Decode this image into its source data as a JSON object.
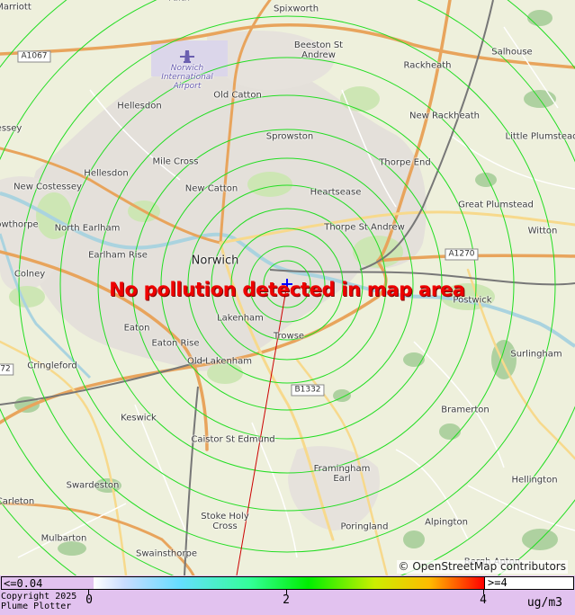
{
  "map": {
    "message": "No pollution detected in map area",
    "attribution": "© OpenStreetMap contributors",
    "places": [
      {
        "id": "faith",
        "name": "Faith"
      },
      {
        "id": "spixworth",
        "name": "Spixworth"
      },
      {
        "id": "marriott",
        "name": "Marriott"
      },
      {
        "id": "beeston-st-andrew",
        "name": "Beeston St\nAndrew"
      },
      {
        "id": "salhouse",
        "name": "Salhouse"
      },
      {
        "id": "rackheath",
        "name": "Rackheath"
      },
      {
        "id": "norwich-airport",
        "name": "Norwich\nInternational\nAirport"
      },
      {
        "id": "old-catton",
        "name": "Old Catton"
      },
      {
        "id": "hellesdon-north",
        "name": "Hellesdon"
      },
      {
        "id": "essey",
        "name": "essey"
      },
      {
        "id": "new-rackheath",
        "name": "New Rackheath"
      },
      {
        "id": "sprowston",
        "name": "Sprowston"
      },
      {
        "id": "little-plumstead",
        "name": "Little Plumstead"
      },
      {
        "id": "mile-cross",
        "name": "Mile Cross"
      },
      {
        "id": "thorpe-end",
        "name": "Thorpe End"
      },
      {
        "id": "hellesdon",
        "name": "Hellesdon"
      },
      {
        "id": "new-costessey",
        "name": "New Costessey"
      },
      {
        "id": "new-catton",
        "name": "New Catton"
      },
      {
        "id": "heartsease",
        "name": "Heartsease"
      },
      {
        "id": "great-plumstead",
        "name": "Great Plumstead"
      },
      {
        "id": "owthorpe",
        "name": "owthorpe"
      },
      {
        "id": "north-earlham",
        "name": "North Earlham"
      },
      {
        "id": "thorpe-st-andrew",
        "name": "Thorpe St Andrew"
      },
      {
        "id": "witton",
        "name": "Witton"
      },
      {
        "id": "earlham-rise",
        "name": "Earlham Rise"
      },
      {
        "id": "norwich",
        "name": "Norwich"
      },
      {
        "id": "colney",
        "name": "Colney"
      },
      {
        "id": "postwick",
        "name": "Postwick"
      },
      {
        "id": "lakenham",
        "name": "Lakenham"
      },
      {
        "id": "eaton",
        "name": "Eaton"
      },
      {
        "id": "trowse",
        "name": "Trowse"
      },
      {
        "id": "eaton-rise",
        "name": "Eaton Rise"
      },
      {
        "id": "surlingham",
        "name": "Surlingham"
      },
      {
        "id": "cringleford",
        "name": "Cringleford"
      },
      {
        "id": "old-lakenham",
        "name": "Old Lakenham"
      },
      {
        "id": "bramerton",
        "name": "Bramerton"
      },
      {
        "id": "keswick",
        "name": "Keswick"
      },
      {
        "id": "caistor-st-edmund",
        "name": "Caistor St Edmund"
      },
      {
        "id": "framingham-earl",
        "name": "Framingham\nEarl"
      },
      {
        "id": "swardeston",
        "name": "Swardeston"
      },
      {
        "id": "hellington",
        "name": "Hellington"
      },
      {
        "id": "carleton",
        "name": "Carleton"
      },
      {
        "id": "stoke-holy-cross",
        "name": "Stoke Holy\nCross"
      },
      {
        "id": "poringland",
        "name": "Poringland"
      },
      {
        "id": "alpington",
        "name": "Alpington"
      },
      {
        "id": "mulbarton",
        "name": "Mulbarton"
      },
      {
        "id": "swainsthorpe",
        "name": "Swainsthorpe"
      },
      {
        "id": "bergh-apton",
        "name": "Bergh Apton"
      }
    ],
    "road_shields": [
      {
        "id": "a1067",
        "name": "A1067"
      },
      {
        "id": "a1270",
        "name": "A1270"
      },
      {
        "id": "b1332",
        "name": "B1332"
      },
      {
        "id": "r72",
        "name": "72"
      }
    ]
  },
  "legend": {
    "low_label": "<=0.04",
    "high_label": ">=4",
    "ticks": [
      {
        "label": "0",
        "value": 0
      },
      {
        "label": "2",
        "value": 2
      },
      {
        "label": "4",
        "value": 4
      }
    ],
    "scale_min": 0,
    "scale_max": 4,
    "units": "ug/m3",
    "copyright_line1": "Copyright 2025",
    "copyright_line2": "Plume Plotter"
  },
  "colors": {
    "contour_rings": "#22dd22",
    "message": "#ee0000",
    "source_marker": "#0000ff",
    "bearing_line": "#cc0000",
    "legend_background": "#e2c2ef"
  }
}
